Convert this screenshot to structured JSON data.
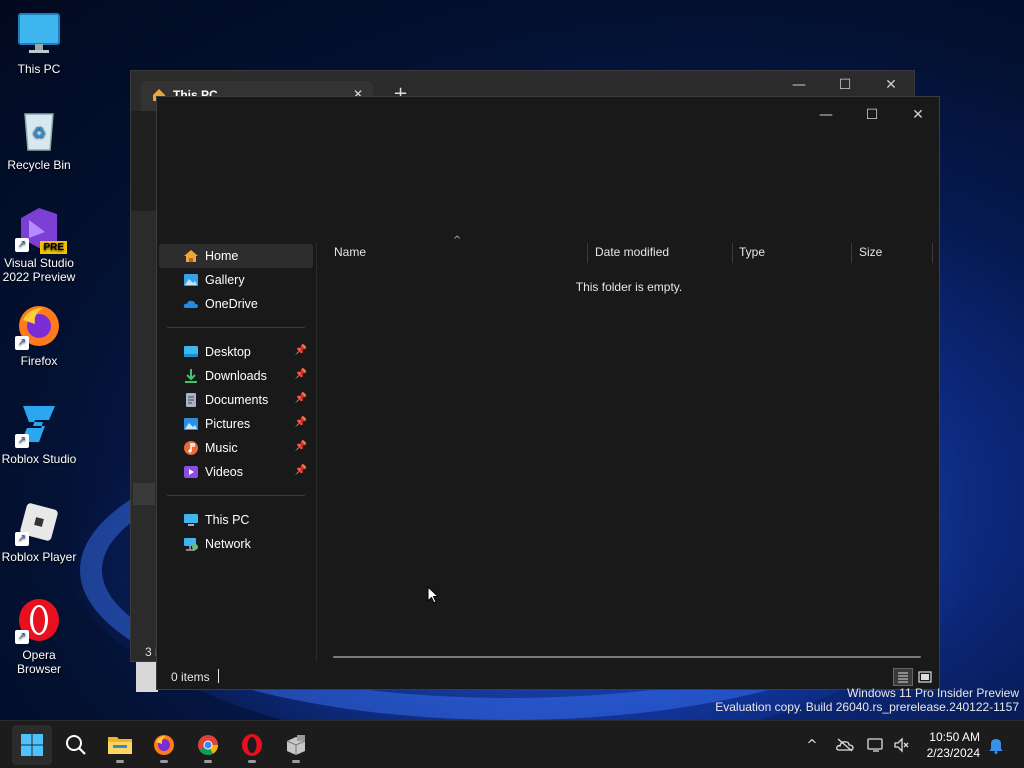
{
  "desktop": {
    "icons": [
      {
        "label": "This PC"
      },
      {
        "label": "Recycle Bin"
      },
      {
        "label": "Visual Studio 2022 Preview",
        "badge": "PRE"
      },
      {
        "label": "Firefox"
      },
      {
        "label": "Roblox Studio"
      },
      {
        "label": "Roblox Player"
      },
      {
        "label": "Opera Browser"
      }
    ]
  },
  "back_window": {
    "tab_title": "This PC",
    "tab_close": "✕",
    "new_tab": "+",
    "status_partial": "3 i"
  },
  "explorer": {
    "controls": {
      "minimize": "—",
      "maximize": "☐",
      "close": "✕"
    },
    "nav": {
      "top": [
        {
          "label": "Home",
          "icon": "home-icon",
          "active": true
        },
        {
          "label": "Gallery",
          "icon": "gallery-icon"
        },
        {
          "label": "OneDrive",
          "icon": "onedrive-icon"
        }
      ],
      "pinned": [
        {
          "label": "Desktop",
          "icon": "desktop-folder-icon"
        },
        {
          "label": "Downloads",
          "icon": "downloads-icon"
        },
        {
          "label": "Documents",
          "icon": "documents-icon"
        },
        {
          "label": "Pictures",
          "icon": "pictures-icon"
        },
        {
          "label": "Music",
          "icon": "music-icon"
        },
        {
          "label": "Videos",
          "icon": "videos-icon"
        }
      ],
      "bottom": [
        {
          "label": "This PC",
          "icon": "this-pc-icon"
        },
        {
          "label": "Network",
          "icon": "network-icon"
        }
      ],
      "pin_glyph": "📌"
    },
    "columns": [
      "Name",
      "Date modified",
      "Type",
      "Size"
    ],
    "sort_glyph": "^",
    "empty_message": "This folder is empty.",
    "status": "0 items"
  },
  "watermark": {
    "line1": "Windows 11 Pro Insider Preview",
    "line2": "Evaluation copy. Build 26040.rs_prerelease.240122-1157"
  },
  "taskbar": {
    "apps": [
      "start",
      "search",
      "file-explorer",
      "firefox",
      "chrome",
      "opera",
      "package"
    ],
    "clock_time": "10:50 AM",
    "clock_date": "2/23/2024",
    "tray_chevron": "^"
  },
  "colors": {
    "accent": "#0078d4",
    "window_bg": "#191919",
    "taskbar_bg": "#1c1c1c"
  }
}
